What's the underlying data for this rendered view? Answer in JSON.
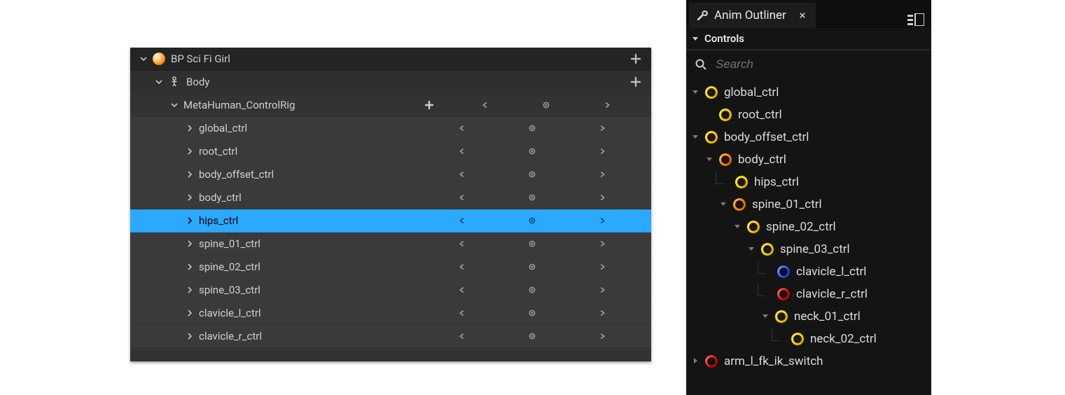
{
  "sequencer": {
    "actor_label": "BP Sci Fi Girl",
    "body_label": "Body",
    "controlrig_label": "MetaHuman_ControlRig",
    "tracks": [
      {
        "label": "global_ctrl",
        "selected": false
      },
      {
        "label": "root_ctrl",
        "selected": false
      },
      {
        "label": "body_offset_ctrl",
        "selected": false
      },
      {
        "label": "body_ctrl",
        "selected": false
      },
      {
        "label": "hips_ctrl",
        "selected": true
      },
      {
        "label": "spine_01_ctrl",
        "selected": false
      },
      {
        "label": "spine_02_ctrl",
        "selected": false
      },
      {
        "label": "spine_03_ctrl",
        "selected": false
      },
      {
        "label": "clavicle_l_ctrl",
        "selected": false
      },
      {
        "label": "clavicle_r_ctrl",
        "selected": false
      }
    ]
  },
  "anim_outliner": {
    "tab_title": "Anim Outliner",
    "section_title": "Controls",
    "search_placeholder": "Search",
    "tree": [
      {
        "label": "global_ctrl",
        "indent": 0,
        "color": "yellow",
        "expander": "down"
      },
      {
        "label": "root_ctrl",
        "indent": 1,
        "color": "yellow",
        "expander": "none"
      },
      {
        "label": "body_offset_ctrl",
        "indent": 0,
        "color": "yellow",
        "expander": "down"
      },
      {
        "label": "body_ctrl",
        "indent": 1,
        "color": "orange",
        "expander": "down"
      },
      {
        "label": "hips_ctrl",
        "indent": 2,
        "color": "yellow",
        "expander": "none",
        "elbow": true
      },
      {
        "label": "spine_01_ctrl",
        "indent": 2,
        "color": "orange",
        "expander": "down"
      },
      {
        "label": "spine_02_ctrl",
        "indent": 3,
        "color": "yellow",
        "expander": "down"
      },
      {
        "label": "spine_03_ctrl",
        "indent": 4,
        "color": "yellow",
        "expander": "down"
      },
      {
        "label": "clavicle_l_ctrl",
        "indent": 5,
        "color": "blue",
        "expander": "none",
        "elbow": true
      },
      {
        "label": "clavicle_r_ctrl",
        "indent": 5,
        "color": "red",
        "expander": "none",
        "elbow": true
      },
      {
        "label": "neck_01_ctrl",
        "indent": 5,
        "color": "yellow",
        "expander": "down"
      },
      {
        "label": "neck_02_ctrl",
        "indent": 6,
        "color": "yellow",
        "expander": "none",
        "elbow": true
      },
      {
        "label": "arm_l_fk_ik_switch",
        "indent": 0,
        "color": "red",
        "expander": "right"
      }
    ]
  }
}
